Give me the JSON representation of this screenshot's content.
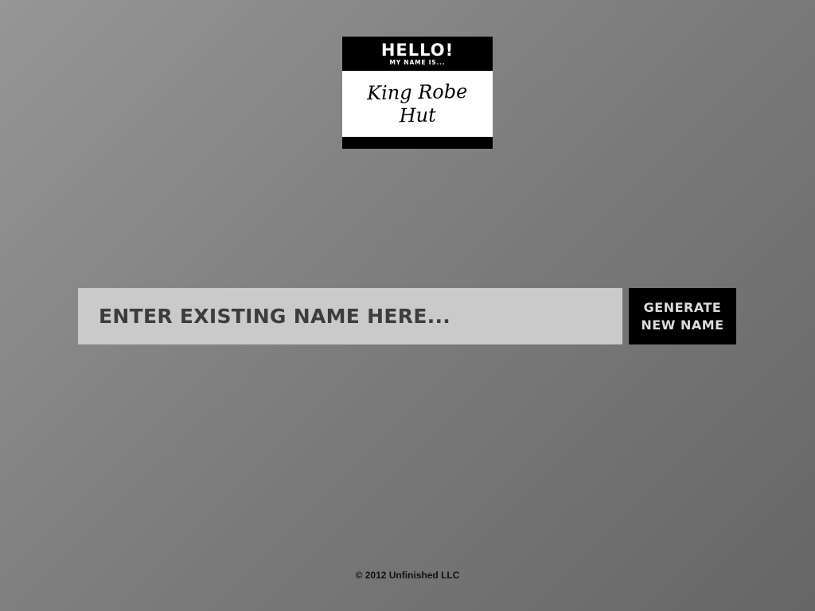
{
  "name_tag": {
    "hello": "HELLO!",
    "subtitle": "MY NAME IS...",
    "generated_name": "King Robe Hut"
  },
  "input": {
    "placeholder": "ENTER EXISTING NAME HERE...",
    "value": ""
  },
  "generate_button": {
    "line1": "GENERATE",
    "line2": "NEW NAME"
  },
  "footer": {
    "copyright": "© 2012 Unfinished LLC"
  },
  "colors": {
    "background": "#7c7c7c",
    "tag": "#000000",
    "input_bg": "#cacaca",
    "button_bg": "#000000"
  }
}
